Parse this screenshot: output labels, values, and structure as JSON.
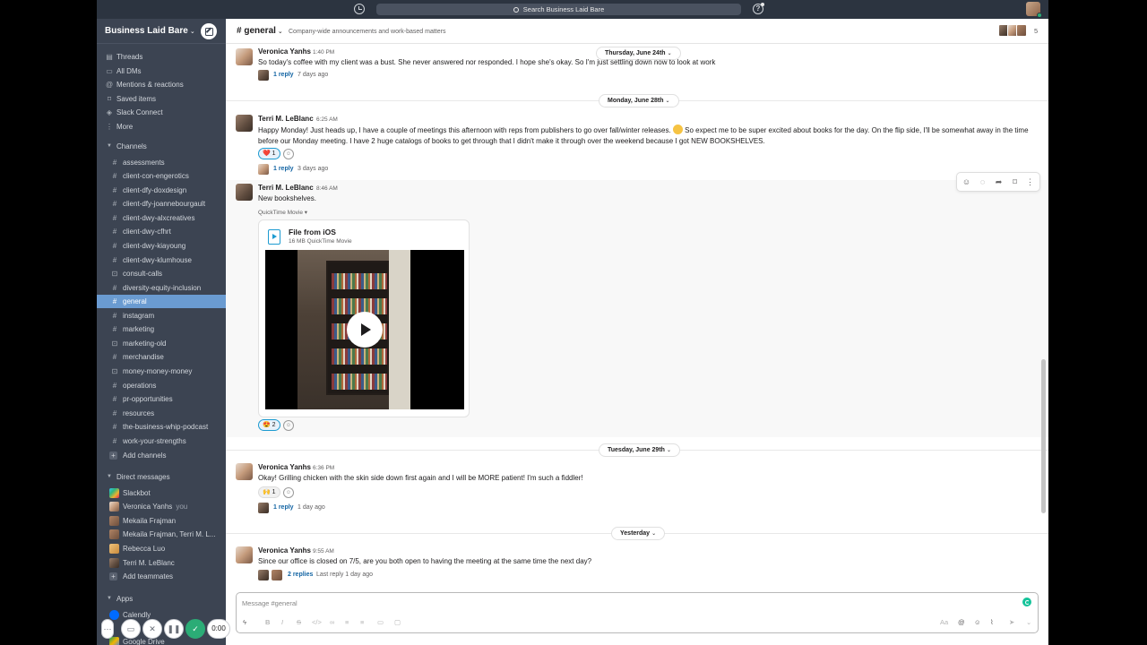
{
  "topbar": {
    "search_placeholder": "Search Business Laid Bare",
    "help_glyph": "?"
  },
  "sidebar": {
    "workspace_name": "Business Laid Bare",
    "nav_items": [
      {
        "label": "Threads",
        "icon": "threads-icon"
      },
      {
        "label": "All DMs",
        "icon": "dms-icon"
      },
      {
        "label": "Mentions & reactions",
        "icon": "at-icon"
      },
      {
        "label": "Saved items",
        "icon": "bookmark-icon"
      },
      {
        "label": "Slack Connect",
        "icon": "connect-icon"
      },
      {
        "label": "More",
        "icon": "more-icon"
      }
    ],
    "channels_header": "Channels",
    "channels": [
      {
        "label": "assessments",
        "private": false
      },
      {
        "label": "client-con-engerotics",
        "private": false
      },
      {
        "label": "client-dfy-doxdesign",
        "private": false
      },
      {
        "label": "client-dfy-joannebourgault",
        "private": false
      },
      {
        "label": "client-dwy-alxcreatives",
        "private": false
      },
      {
        "label": "client-dwy-cfhrt",
        "private": false
      },
      {
        "label": "client-dwy-kiayoung",
        "private": false
      },
      {
        "label": "client-dwy-klumhouse",
        "private": false
      },
      {
        "label": "consult-calls",
        "private": true
      },
      {
        "label": "diversity-equity-inclusion",
        "private": false
      },
      {
        "label": "general",
        "private": false,
        "active": true
      },
      {
        "label": "instagram",
        "private": false
      },
      {
        "label": "marketing",
        "private": false
      },
      {
        "label": "marketing-old",
        "private": true
      },
      {
        "label": "merchandise",
        "private": false
      },
      {
        "label": "money-money-money",
        "private": true
      },
      {
        "label": "operations",
        "private": false
      },
      {
        "label": "pr-opportunities",
        "private": false
      },
      {
        "label": "resources",
        "private": false
      },
      {
        "label": "the-business-whip-podcast",
        "private": false
      },
      {
        "label": "work-your-strengths",
        "private": false
      }
    ],
    "add_channels": "Add channels",
    "dms_header": "Direct messages",
    "dms": [
      {
        "label": "Slackbot",
        "you": ""
      },
      {
        "label": "Veronica Yanhs",
        "you": "you"
      },
      {
        "label": "Mekaila Frajman",
        "you": ""
      },
      {
        "label": "Mekaila Frajman, Terri M. L...",
        "you": ""
      },
      {
        "label": "Rebecca Luo",
        "you": ""
      },
      {
        "label": "Terri M. LeBlanc",
        "you": ""
      }
    ],
    "add_teammates": "Add teammates",
    "apps_header": "Apps",
    "apps": [
      {
        "label": "Calendly"
      },
      {
        "label": "Google Drive"
      }
    ]
  },
  "recorder": {
    "time": "0:00"
  },
  "channel": {
    "name": "# general",
    "topic": "Company-wide announcements and work-based matters",
    "member_count": "5"
  },
  "dates": {
    "d1": "Thursday, June 24th",
    "d2": "Monday, June 28th",
    "d3": "Tuesday, June 29th",
    "d4": "Yesterday"
  },
  "messages": [
    {
      "author": "Veronica Yanhs",
      "time": "1:40 PM",
      "text": "So today's coffee with my client was a bust. She never answered nor responded. I hope she's okay. So I'm just settling down now to look at work",
      "replies": "1 reply",
      "reply_ago": "7 days ago"
    },
    {
      "author": "Terri M. LeBlanc",
      "time": "6:25 AM",
      "text_a": "Happy Monday! Just heads up, I have a couple of meetings this afternoon with reps from publishers to go over fall/winter releases.",
      "text_b": "So expect me to be super excited about books for the day. On the flip side, I'll be somewhat away in the time before our Monday meeting. I have 2 huge catalogs of books to get through that I didn't make it through over the weekend because I got NEW BOOKSHELVES.",
      "reaction": "❤️ 1",
      "replies": "1 reply",
      "reply_ago": "3 days ago"
    },
    {
      "author": "Terri M. LeBlanc",
      "time": "8:46 AM",
      "text": "New bookshelves.",
      "file_kind": "QuickTime Movie",
      "file_title": "File from iOS",
      "file_sub": "16 MB QuickTime Movie",
      "reaction": "😍 2"
    },
    {
      "author": "Veronica Yanhs",
      "time": "6:36 PM",
      "text": "Okay! Grilling chicken with the skin side down first again and I will be MORE patient! I'm such a fiddler!",
      "reaction": "🙌 1",
      "replies": "1 reply",
      "reply_ago": "1 day ago"
    },
    {
      "author": "Veronica Yanhs",
      "time": "9:55 AM",
      "text": "Since our office is closed on 7/5, are you both open to having the meeting at the same time the next day?",
      "replies": "2 replies",
      "reply_ago": "Last reply 1 day ago"
    }
  ],
  "composer": {
    "placeholder": "Message #general"
  }
}
